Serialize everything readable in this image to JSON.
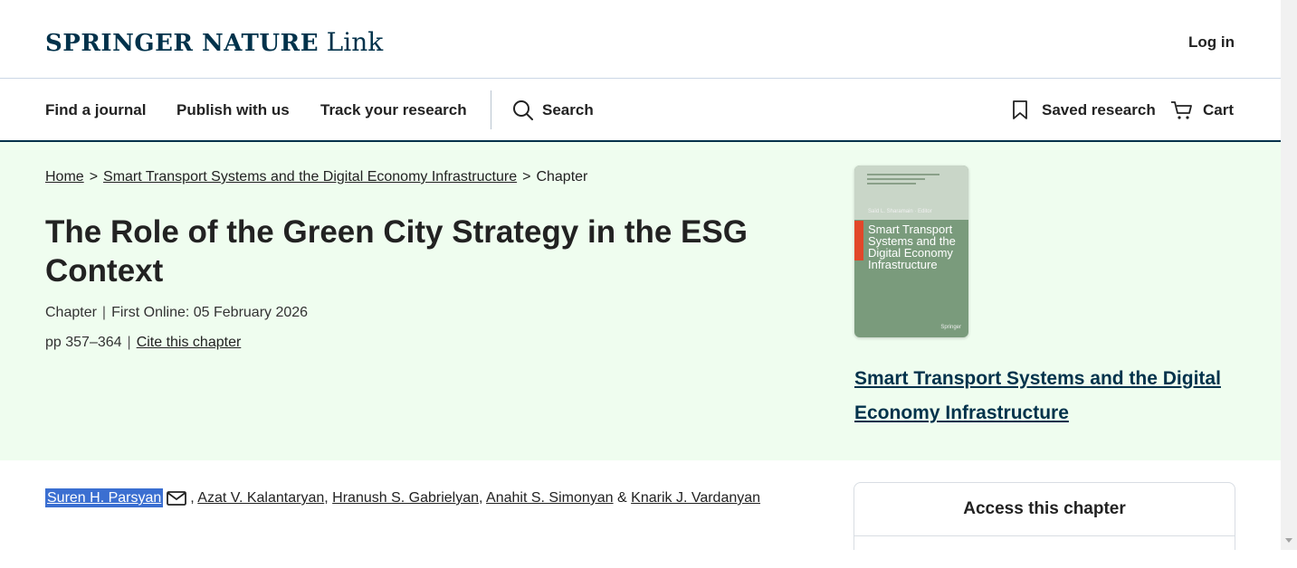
{
  "header": {
    "logo": {
      "springer_nature": "SPRINGER NATURE",
      "link": "Link"
    },
    "login": "Log in"
  },
  "nav": {
    "find_journal": "Find a journal",
    "publish": "Publish with us",
    "track": "Track your research",
    "search": "Search",
    "saved": "Saved research",
    "cart": "Cart"
  },
  "breadcrumb": {
    "home": "Home",
    "sep": ">",
    "book": "Smart Transport Systems and the Digital Economy Infrastructure",
    "current": "Chapter"
  },
  "chapter": {
    "title": "The Role of the Green City Strategy in the ESG Context",
    "type": "Chapter",
    "first_online": "First Online: 05 February 2026",
    "pages": "pp 357–364",
    "cite": "Cite this chapter",
    "divider": "|"
  },
  "book": {
    "cover_editor": "Saïd L. Sharamain · Editor",
    "cover_title": "Smart Transport Systems and the Digital Economy Infrastructure",
    "cover_publisher": "Springer",
    "link_text": "Smart Transport Systems and the Digital Economy Infrastructure"
  },
  "authors": {
    "a1": "Suren H. Parsyan",
    "a2": "Azat V. Kalantaryan",
    "a3": "Hranush S. Gabrielyan",
    "a4": "Anahit S. Simonyan",
    "a5": "Knarik J. Vardanyan",
    "comma": ",",
    "amp": "&"
  },
  "access": {
    "title": "Access this chapter"
  },
  "colors": {
    "brand": "#01324b",
    "hero_bg": "#effdef",
    "highlight": "#3b6fd1"
  }
}
